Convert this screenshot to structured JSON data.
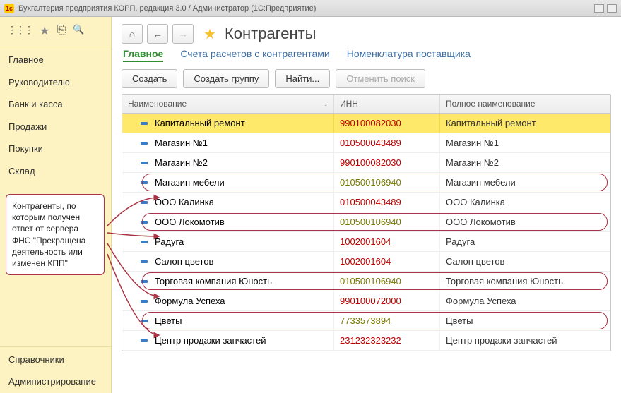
{
  "window": {
    "title": "Бухгалтерия предприятия КОРП, редакция 3.0 / Администратор  (1С:Предприятие)"
  },
  "sidebar": {
    "icons": {
      "apps": "⋮⋮⋮",
      "star": "★",
      "clip": "⎘",
      "search": "🔍"
    },
    "items": [
      "Главное",
      "Руководителю",
      "Банк и касса",
      "Продажи",
      "Покупки",
      "Склад"
    ],
    "items2": [
      "Справочники",
      "Администрирование"
    ]
  },
  "header": {
    "home": "⌂",
    "back": "←",
    "fwd": "→",
    "star": "★",
    "title": "Контрагенты"
  },
  "tabs": [
    "Главное",
    "Счета расчетов с контрагентами",
    "Номенклатура поставщика"
  ],
  "active_tab": 0,
  "toolbar": {
    "create": "Создать",
    "create_group": "Создать группу",
    "find": "Найти...",
    "cancel_find": "Отменить поиск"
  },
  "grid": {
    "headers": {
      "name": "Наименование",
      "sort": "↓",
      "inn": "ИНН",
      "full": "Полное наименование"
    },
    "rows": [
      {
        "name": "Капитальный ремонт",
        "inn": "990100082030",
        "inn_cls": "inn-red",
        "full": "Капитальный ремонт",
        "sel": true
      },
      {
        "name": "Магазин №1",
        "inn": "010500043489",
        "inn_cls": "inn-red",
        "full": "Магазин №1"
      },
      {
        "name": "Магазин №2",
        "inn": "990100082030",
        "inn_cls": "inn-red",
        "full": "Магазин №2"
      },
      {
        "name": "Магазин мебели",
        "inn": "010500106940",
        "inn_cls": "inn-olive",
        "full": "Магазин мебели",
        "circ": true
      },
      {
        "name": "ООО Калинка",
        "inn": "010500043489",
        "inn_cls": "inn-red",
        "full": "ООО Калинка"
      },
      {
        "name": "ООО Локомотив",
        "inn": "010500106940",
        "inn_cls": "inn-olive",
        "full": "ООО Локомотив",
        "circ": true
      },
      {
        "name": "Радуга",
        "inn": "1002001604",
        "inn_cls": "inn-red",
        "full": "Радуга"
      },
      {
        "name": "Салон цветов",
        "inn": "1002001604",
        "inn_cls": "inn-red",
        "full": "Салон цветов"
      },
      {
        "name": "Торговая компания Юность",
        "inn": "010500106940",
        "inn_cls": "inn-olive",
        "full": "Торговая компания Юность",
        "circ": true
      },
      {
        "name": "Формула Успеха",
        "inn": "990100072000",
        "inn_cls": "inn-red",
        "full": "Формула Успеха"
      },
      {
        "name": "Цветы",
        "inn": "7733573894",
        "inn_cls": "inn-olive",
        "full": "Цветы",
        "circ": true
      },
      {
        "name": "Центр продажи запчастей",
        "inn": "231232323232",
        "inn_cls": "inn-red",
        "full": "Центр продажи запчастей"
      }
    ]
  },
  "callout": "Контрагенты, по которым получен ответ от сервера ФНС \"Прекращена деятельность или изменен КПП\""
}
